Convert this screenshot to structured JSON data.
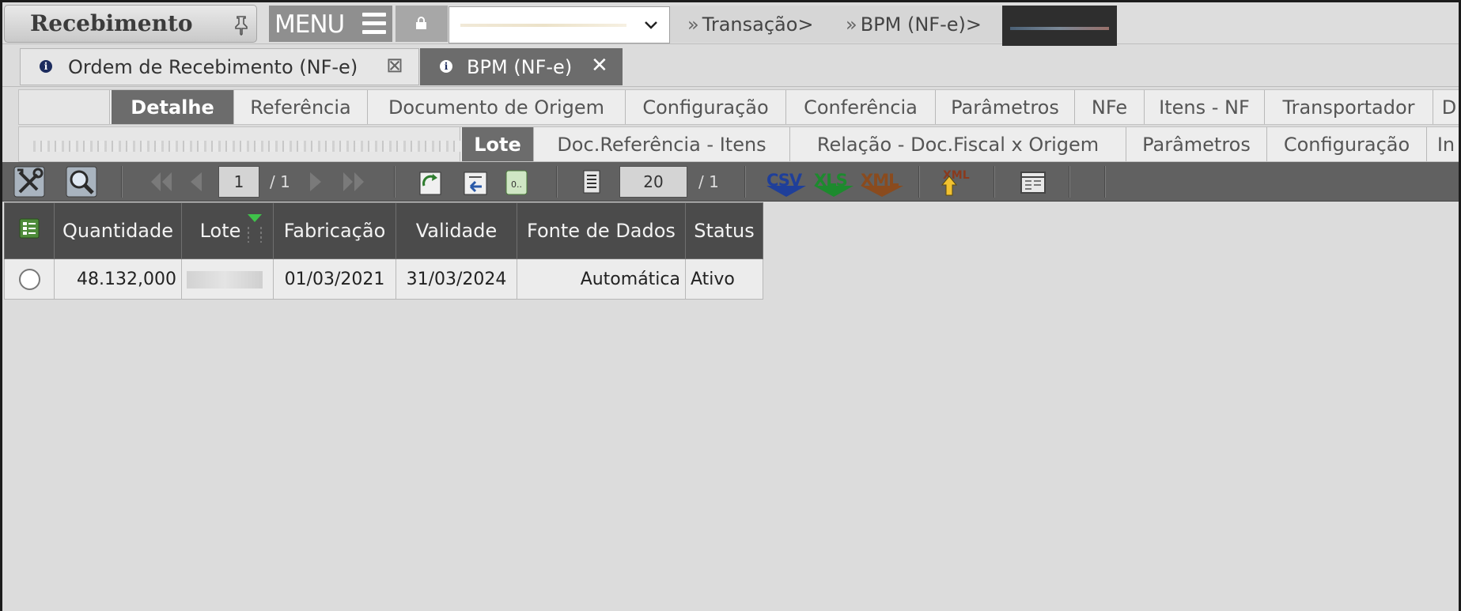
{
  "app": {
    "title": "Recebimento",
    "menu_label": "MENU"
  },
  "breadcrumbs": [
    "Transação>",
    "BPM (NF-e)>"
  ],
  "window_tabs": [
    {
      "label": "Ordem de Recebimento (NF-e)",
      "active": false
    },
    {
      "label": "BPM (NF-e)",
      "active": true
    }
  ],
  "detail_tabs": [
    "Detalhe",
    "Referência",
    "Documento de Origem",
    "Configuração",
    "Conferência",
    "Parâmetros",
    "NFe",
    "Itens - NF",
    "Transportador",
    "D"
  ],
  "detail_tabs_active": "Detalhe",
  "sub_tabs": [
    "Lote",
    "Doc.Referência - Itens",
    "Relação - Doc.Fiscal x Origem",
    "Parâmetros",
    "Configuração",
    "In"
  ],
  "sub_tabs_active": "Lote",
  "toolbar": {
    "page_current": "1",
    "page_total": "/ 1",
    "rows_per_page": "20",
    "rows_total": "/ 1",
    "export_csv": "CSV",
    "export_xls": "XLS",
    "export_xml": "XML",
    "xml_upload": "XML",
    "colors": {
      "csv": "#1f3f9a",
      "xls": "#1d8a2e",
      "xml": "#8a4b1e"
    }
  },
  "table": {
    "columns": [
      "Quantidade",
      "Lote",
      "Fabricação",
      "Validade",
      "Fonte de Dados",
      "Status"
    ],
    "rows": [
      {
        "quantidade": "48.132,000",
        "lote": "",
        "fabricacao": "01/03/2021",
        "validade": "31/03/2024",
        "fonte": "Automática",
        "status": "Ativo"
      }
    ]
  }
}
